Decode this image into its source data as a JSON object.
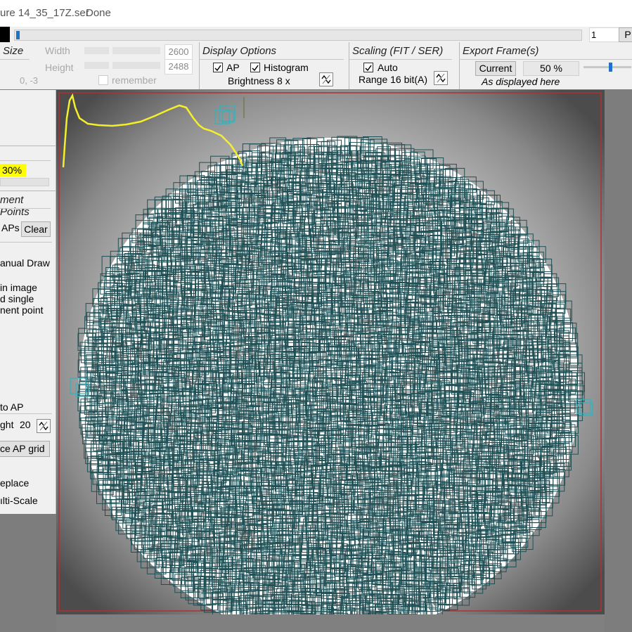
{
  "window": {
    "title": "ure 14_35_17Z.ser",
    "status": "Done"
  },
  "framebar": {
    "frame_value": "1",
    "right_button": "P"
  },
  "size": {
    "header": "Size",
    "width_label": "Width",
    "height_label": "Height",
    "width_value": "2600",
    "height_value": "2488",
    "offset": "0, -3",
    "remember_label": "remember"
  },
  "display": {
    "header": "Display Options",
    "ap_label": "AP",
    "histogram_label": "Histogram",
    "brightness": "Brightness 8 x"
  },
  "scaling": {
    "header": "Scaling (FIT / SER)",
    "auto_label": "Auto",
    "range": "Range 16 bit(A)"
  },
  "export": {
    "header": "Export Frame(s)",
    "current_button": "Current",
    "zoom": "50 %",
    "as_displayed": "As displayed here"
  },
  "left": {
    "quality_value": "30%",
    "ap_header": "ment Points",
    "aps_label": "APs",
    "clear_button": "Clear",
    "manual_draw": "anual Draw",
    "help_lines": [
      "in image",
      "d single",
      "nent point"
    ],
    "to_ap": "to AP",
    "height_label": "ght",
    "height_value": "20",
    "place_grid_button": "ce AP grid",
    "replace_label": "eplace",
    "multiscale_label": "ılti-Scale"
  },
  "colors": {
    "ap_box": "#1f4f54",
    "histogram": "#f5ef2a",
    "highlight": "#ffff00",
    "frame_border": "#b03030"
  },
  "icons": {
    "spin": "spin-arrows-icon",
    "checkbox": "checkbox-icon"
  }
}
